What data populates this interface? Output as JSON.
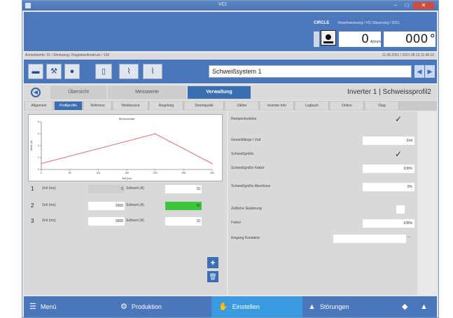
{
  "window": {
    "title": "VCI",
    "min": "–",
    "max": "□",
    "close": "✕"
  },
  "header": {
    "brand": "CIRCLE",
    "info": "Vorschweissung / VCI Steuerung / 2021",
    "readout1_value": "0",
    "readout1_unit": "A/mm",
    "readout2_value": "000",
    "readout2_unit": "°"
  },
  "pathbar": {
    "left": "Anmeldeinfo: 01 / Werkzeug: Doppelwellendruck / 100",
    "right": "11.08.2021 / 2021 08 13 11:46:10"
  },
  "toolbar": {
    "buttons": [
      "folder-icon",
      "wrench-icon",
      "drop-icon",
      "page-icon",
      "chart-icon",
      "chart2-icon"
    ],
    "system_name": "Schweißsystem 1",
    "prev": "◀",
    "next": "▶"
  },
  "main_tabs": {
    "circle_icon": "◀",
    "tabs": [
      "Übersicht",
      "Messwerte",
      "Verwaltung"
    ],
    "active": 2,
    "inverter_title": "Inverter 1 | Schweissprofil2"
  },
  "sub_tabs": {
    "tabs": [
      "Allgemein",
      "Profilprofile",
      "Referenz",
      "Weldsource",
      "Regelung",
      "Stromquelle",
      "Zähler",
      "Inverter-Info",
      "Logbuch",
      "Online",
      "Diag"
    ],
    "active": 1
  },
  "chart_data": {
    "type": "line",
    "title": "Stromverlauf",
    "xlabel": "Zeit (ms)",
    "ylabel": "Strom (A)",
    "x": [
      0,
      2000,
      3000
    ],
    "y": [
      1,
      6,
      1
    ],
    "xticks": [
      "0",
      "50",
      "100",
      "150",
      "200",
      "250",
      "300"
    ],
    "xlim": [
      0,
      3000
    ],
    "ylim": [
      0,
      8
    ],
    "yticks": [
      "8",
      "6",
      "4",
      "2",
      "0"
    ],
    "color": "#e07070",
    "grid": false
  },
  "steps": [
    {
      "num": "1",
      "label1": "Zeit (ms)",
      "value1": "0",
      "label2": "Sollwert (A)",
      "value2": "10"
    },
    {
      "num": "2",
      "label1": "Zeit (ms)",
      "value1": "2000",
      "label2": "Sollwert (A)",
      "value2": "50"
    },
    {
      "num": "3",
      "label1": "Zeit (ms)",
      "value1": "3000",
      "label2": "Sollwert (A)",
      "value2": "10"
    }
  ],
  "step_actions": {
    "add": "+",
    "delete": "🗑"
  },
  "properties": [
    {
      "label": "Rampenfunktion",
      "type": "check",
      "value": "✓"
    },
    {
      "label": "Gesamtlänge / Zeit",
      "type": "value",
      "value": "Zeit"
    },
    {
      "label": "Schweißgröße",
      "type": "check",
      "value": "✓"
    },
    {
      "label": "Schweißgröße Faktor",
      "type": "value",
      "value": "100%"
    },
    {
      "label": "Schweißgröße Abschluss",
      "type": "value",
      "value": "0%"
    },
    {
      "label": "Zeitliche Skalierung",
      "type": "box",
      "value": ""
    },
    {
      "label": "Faktor",
      "type": "value",
      "value": "100%"
    },
    {
      "label": "Eingang Kontaktor",
      "type": "wide",
      "value": "",
      "dots": "..."
    }
  ],
  "bottom_nav": [
    {
      "icon": "menu-icon",
      "glyph": "☰",
      "label": "Menü"
    },
    {
      "icon": "production-icon",
      "glyph": "⚙",
      "label": "Produktion"
    },
    {
      "icon": "settings-hand-icon",
      "glyph": "✋",
      "label": "Einstellen"
    },
    {
      "icon": "warning-icon",
      "glyph": "▲",
      "label": "Störungen"
    }
  ],
  "bottom_right": {
    "back": "◆",
    "up": "▲"
  }
}
